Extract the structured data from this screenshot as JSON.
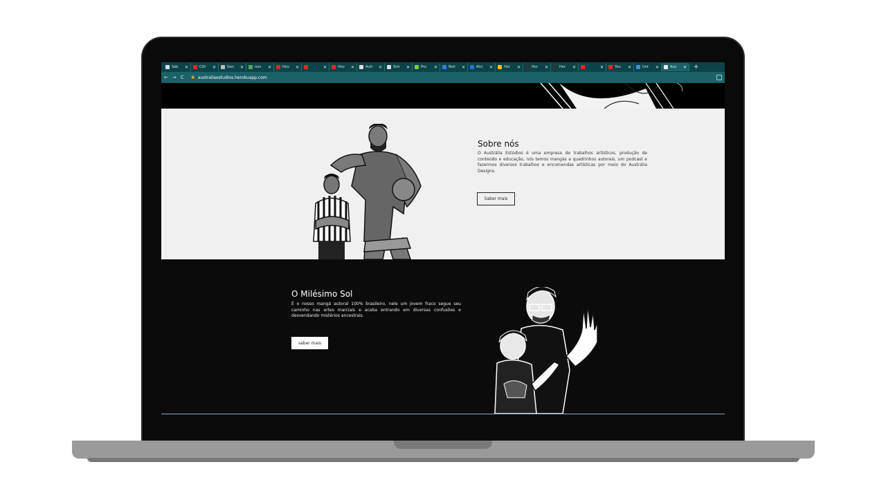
{
  "browser": {
    "tabs": [
      {
        "label": "Sáb",
        "fav": "#cfe3ff"
      },
      {
        "label": "COI",
        "fav": "#e22"
      },
      {
        "label": "Gen",
        "fav": "#bbb"
      },
      {
        "label": "non",
        "fav": "#58a55c"
      },
      {
        "label": "Hov",
        "fav": "#e22"
      },
      {
        "label": "",
        "fav": "#e22"
      },
      {
        "label": "Hov",
        "fav": "#e22"
      },
      {
        "label": "Auti",
        "fav": "#ddd"
      },
      {
        "label": "Sim",
        "fav": "#ddd"
      },
      {
        "label": "Pro",
        "fav": "#7c3"
      },
      {
        "label": "Reti",
        "fav": "#3a7be0"
      },
      {
        "label": "Alct",
        "fav": "#2a6fe0"
      },
      {
        "label": "Hor",
        "fav": "#f5c400"
      },
      {
        "label": "Hor",
        "fav": "#333"
      },
      {
        "label": "Hor",
        "fav": "#333"
      },
      {
        "label": "",
        "fav": "#e22"
      },
      {
        "label": "You",
        "fav": "#e22"
      },
      {
        "label": "Unt",
        "fav": "#3a8fe0"
      },
      {
        "label": "Aus",
        "fav": "#eee",
        "active": true
      }
    ],
    "newtab_icon": "+",
    "close_glyph": "✕",
    "url": "australiaestudios.herokuapp.com",
    "nav": {
      "back": "←",
      "forward": "→",
      "reload": "C"
    }
  },
  "sobre": {
    "title": "Sobre nós",
    "text": "O Austrália Estúdios é uma empresa de trabalhos artísticos, produção de conteúdo e educação, nós temos mangás e quadrinhos autorais, um podcast e fazermos diversos trabalhos e encomendas artísticas por meio do Austrália Designs.",
    "button": "Saber mais"
  },
  "milesimo": {
    "title": "O Milésimo Sol",
    "text": "É o nosso mangá autoral 100% brasileiro, nele um jovem fraco segue seu caminho nas artes marciais e acaba entrando em diversas confusões e desvendando mistérios ancestrais.",
    "button": "saber mais"
  }
}
